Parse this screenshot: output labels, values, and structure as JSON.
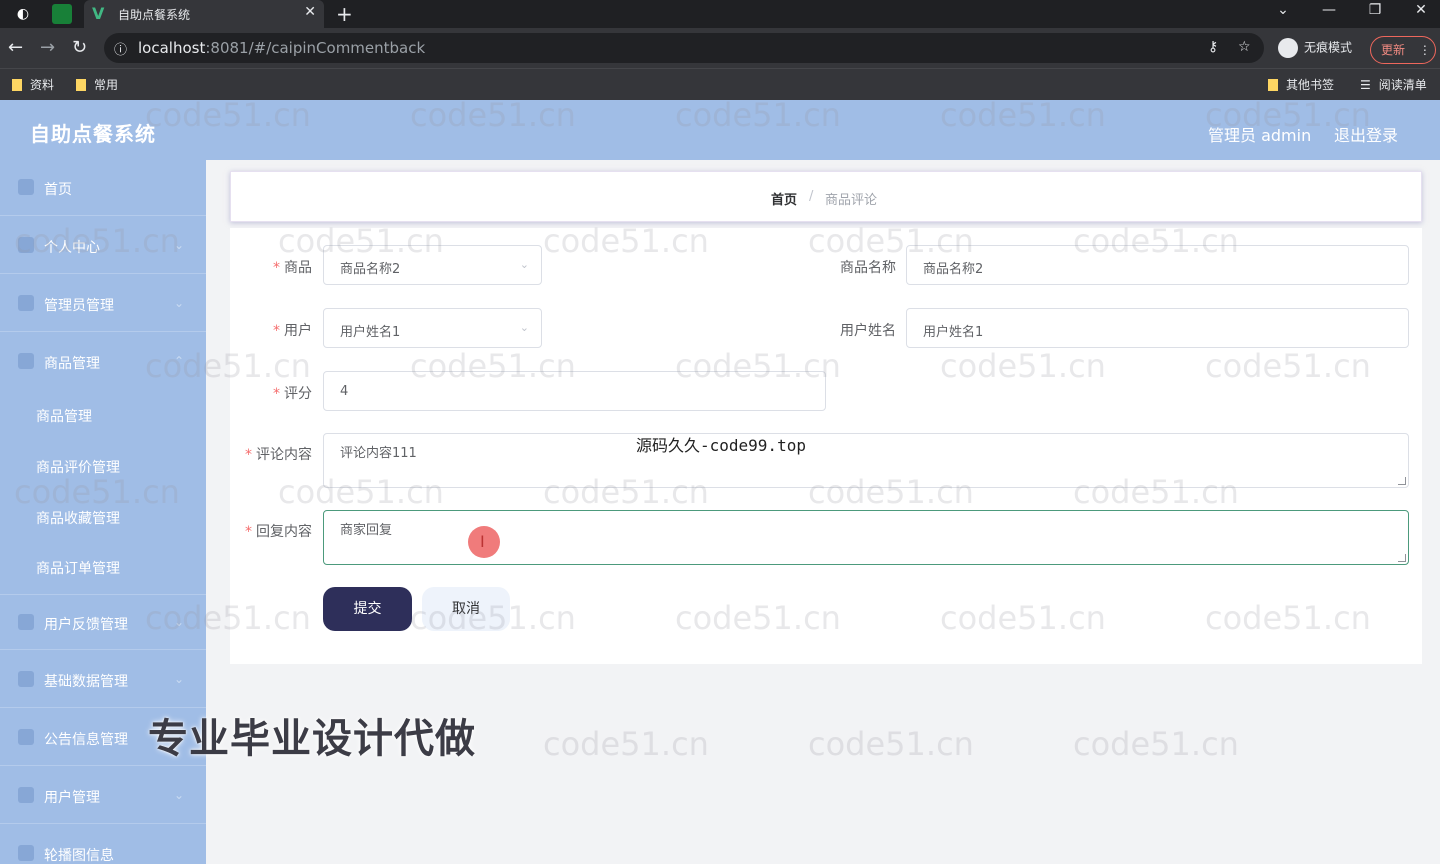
{
  "browser": {
    "tab_title": "自助点餐系统",
    "url_host": "localhost",
    "url_path": ":8081/#/caipinCommentback",
    "profile_label": "无痕模式",
    "update_label": "更新",
    "bookmarks": [
      "资料",
      "常用"
    ],
    "other_bookmarks": "其他书签",
    "reading_list": "阅读清单"
  },
  "app": {
    "title": "自助点餐系统",
    "user_label": "管理员 admin",
    "logout_label": "退出登录"
  },
  "sidebar": {
    "items": [
      {
        "label": "首页"
      },
      {
        "label": "个人中心"
      },
      {
        "label": "管理员管理"
      },
      {
        "label": "商品管理"
      }
    ],
    "subitems": [
      {
        "label": "商品管理"
      },
      {
        "label": "商品评价管理"
      },
      {
        "label": "商品收藏管理"
      },
      {
        "label": "商品订单管理"
      }
    ],
    "items_bottom": [
      {
        "label": "用户反馈管理"
      },
      {
        "label": "基础数据管理"
      },
      {
        "label": "公告信息管理"
      },
      {
        "label": "用户管理"
      },
      {
        "label": "轮播图信息"
      }
    ]
  },
  "breadcrumb": {
    "home": "首页",
    "separator": "/",
    "current": "商品评论"
  },
  "form": {
    "product_label": "商品",
    "product_value": "商品名称2",
    "product_name_label": "商品名称",
    "product_name_value": "商品名称2",
    "user_label": "用户",
    "user_value": "用户姓名1",
    "user_name_label": "用户姓名",
    "user_name_value": "用户姓名1",
    "rating_label": "评分",
    "rating_value": "4",
    "comment_label": "评论内容",
    "comment_value": "评论内容111",
    "reply_label": "回复内容",
    "reply_value": "商家回复",
    "submit_label": "提交",
    "cancel_label": "取消"
  },
  "overlays": {
    "source_text": "源码久久-code99.top",
    "ad_text": "专业毕业设计代做",
    "watermark": "code51.cn"
  },
  "colors": {
    "sidebar_bg": "#a0bde6",
    "submit_bg": "#2e2f5a",
    "required": "#f56c6c"
  }
}
